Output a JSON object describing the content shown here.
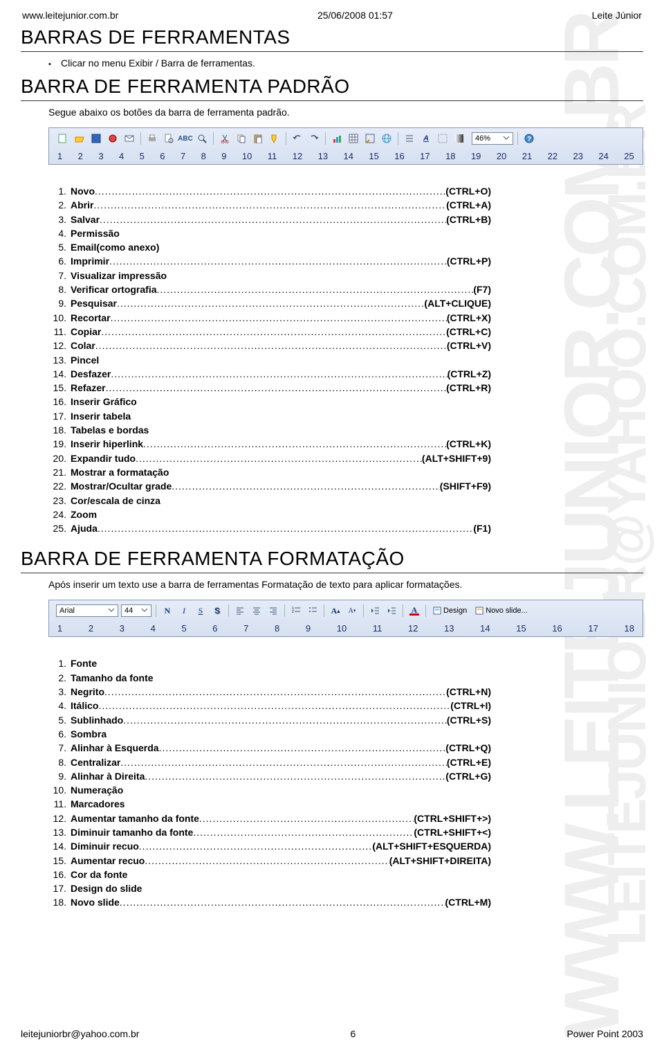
{
  "header": {
    "left": "www.leitejunior.com.br",
    "center": "25/06/2008 01:57",
    "right": "Leite Júnior"
  },
  "watermarks": {
    "wm1": "WWW.LEITEJUNIOR.COM.BR",
    "wm2": "LEITEJUNIOBR@YAHOO.COM.BR"
  },
  "sections": {
    "s1_title": "BARRAS DE FERRAMENTAS",
    "s1_bullet": "Clicar no menu Exibir / Barra de ferramentas.",
    "s2_title": "BARRA DE FERRAMENTA PADRÃO",
    "s2_desc": "Segue abaixo os botões da barra de ferramenta padrão.",
    "s3_title": "BARRA DE FERRAMENTA FORMATAÇÃO",
    "s3_desc": "Após inserir um texto use a barra de ferramentas Formatação de texto para aplicar formatações."
  },
  "toolbar1": {
    "zoom": "46%",
    "numbers": [
      "1",
      "2",
      "3",
      "4",
      "5",
      "6",
      "7",
      "8",
      "9",
      "10",
      "11",
      "12",
      "13",
      "14",
      "15",
      "16",
      "17",
      "18",
      "19",
      "20",
      "21",
      "22",
      "23",
      "24",
      "25"
    ]
  },
  "toolbar2": {
    "font": "Arial",
    "size": "44",
    "design": "Design",
    "novo_slide": "Novo slide...",
    "numbers": [
      "1",
      "2",
      "3",
      "4",
      "5",
      "6",
      "7",
      "8",
      "9",
      "10",
      "11",
      "12",
      "13",
      "14",
      "15",
      "16",
      "17",
      "18"
    ]
  },
  "list1": [
    {
      "n": "1.",
      "label": "Novo",
      "short": "(CTRL+O)"
    },
    {
      "n": "2.",
      "label": "Abrir",
      "short": "(CTRL+A)"
    },
    {
      "n": "3.",
      "label": "Salvar",
      "short": "(CTRL+B)"
    },
    {
      "n": "4.",
      "label": "Permissão",
      "short": ""
    },
    {
      "n": "5.",
      "label": "Email(como anexo)",
      "short": ""
    },
    {
      "n": "6.",
      "label": "Imprimir",
      "short": "(CTRL+P)"
    },
    {
      "n": "7.",
      "label": "Visualizar impressão",
      "short": ""
    },
    {
      "n": "8.",
      "label": "Verificar ortografia",
      "short": "(F7)"
    },
    {
      "n": "9.",
      "label": "Pesquisar",
      "short": "(ALT+CLIQUE)"
    },
    {
      "n": "10.",
      "label": "Recortar",
      "short": "(CTRL+X)"
    },
    {
      "n": "11.",
      "label": "Copiar",
      "short": "(CTRL+C)"
    },
    {
      "n": "12.",
      "label": "Colar",
      "short": "(CTRL+V)"
    },
    {
      "n": "13.",
      "label": "Pincel",
      "short": ""
    },
    {
      "n": "14.",
      "label": "Desfazer",
      "short": "(CTRL+Z)"
    },
    {
      "n": "15.",
      "label": "Refazer",
      "short": "(CTRL+R)"
    },
    {
      "n": "16.",
      "label": "Inserir Gráfico",
      "short": ""
    },
    {
      "n": "17.",
      "label": "Inserir tabela",
      "short": ""
    },
    {
      "n": "18.",
      "label": "Tabelas e bordas",
      "short": ""
    },
    {
      "n": "19.",
      "label": "Inserir hiperlink",
      "short": "(CTRL+K)"
    },
    {
      "n": "20.",
      "label": "Expandir tudo",
      "short": "(ALT+SHIFT+9)"
    },
    {
      "n": "21.",
      "label": "Mostrar a formatação",
      "short": ""
    },
    {
      "n": "22.",
      "label": "Mostrar/Ocultar grade",
      "short": "(SHIFT+F9)"
    },
    {
      "n": "23.",
      "label": "Cor/escala de cinza",
      "short": ""
    },
    {
      "n": "24.",
      "label": "Zoom",
      "short": ""
    },
    {
      "n": "25.",
      "label": "Ajuda",
      "short": "(F1)"
    }
  ],
  "list2": [
    {
      "n": "1.",
      "label": "Fonte",
      "short": ""
    },
    {
      "n": "2.",
      "label": "Tamanho da fonte",
      "short": ""
    },
    {
      "n": "3.",
      "label": "Negrito",
      "short": "(CTRL+N)"
    },
    {
      "n": "4.",
      "label": "Itálico",
      "short": "(CTRL+I)"
    },
    {
      "n": "5.",
      "label": "Sublinhado",
      "short": "(CTRL+S)"
    },
    {
      "n": "6.",
      "label": "Sombra",
      "short": ""
    },
    {
      "n": "7.",
      "label": "Alinhar à Esquerda",
      "short": "(CTRL+Q)"
    },
    {
      "n": "8.",
      "label": "Centralizar",
      "short": "(CTRL+E)"
    },
    {
      "n": "9.",
      "label": "Alinhar à Direita",
      "short": "(CTRL+G)"
    },
    {
      "n": "10.",
      "label": "Numeração",
      "short": ""
    },
    {
      "n": "11.",
      "label": "Marcadores",
      "short": ""
    },
    {
      "n": "12.",
      "label": "Aumentar tamanho da fonte",
      "short": "(CTRL+SHIFT+>)"
    },
    {
      "n": "13.",
      "label": "Diminuir tamanho da fonte",
      "short": "(CTRL+SHIFT+<)"
    },
    {
      "n": "14.",
      "label": "Diminuir recuo",
      "short": "(ALT+SHIFT+ESQUERDA)"
    },
    {
      "n": "15.",
      "label": "Aumentar recuo",
      "short": "(ALT+SHIFT+DIREITA)"
    },
    {
      "n": "16.",
      "label": "Cor da fonte",
      "short": ""
    },
    {
      "n": "17.",
      "label": "Design do slide",
      "short": ""
    },
    {
      "n": "18.",
      "label": "Novo slide",
      "short": "(CTRL+M)"
    }
  ],
  "footer": {
    "left": "leitejuniorbr@yahoo.com.br",
    "center": "6",
    "right": "Power Point 2003"
  }
}
